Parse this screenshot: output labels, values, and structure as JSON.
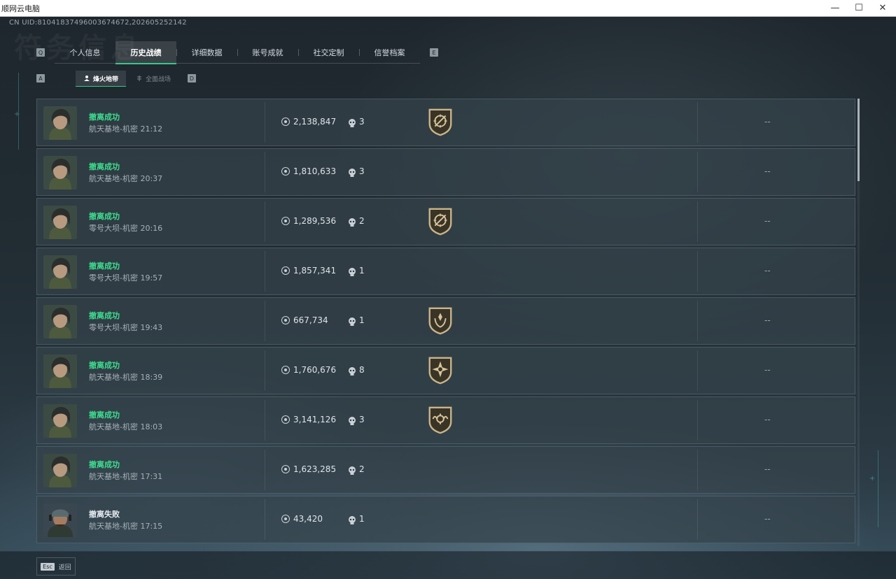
{
  "window": {
    "title": "顺网云电脑",
    "minimize_glyph": "—",
    "maximize_glyph": "☐",
    "close_glyph": "✕"
  },
  "header": {
    "uid": "CN UID:8104183749600367467​2,202605252142",
    "bg_title": "符务信息"
  },
  "tabs": {
    "left_key": "Q",
    "right_key": "E",
    "items": [
      {
        "label": "个人信息"
      },
      {
        "label": "历史战绩"
      },
      {
        "label": "详细数据"
      },
      {
        "label": "账号成就"
      },
      {
        "label": "社交定制"
      },
      {
        "label": "信誉档案"
      }
    ],
    "active_index": 1
  },
  "subtabs": {
    "left_key": "A",
    "right_key": "D",
    "active_label": "烽火地带",
    "inactive_label": "全面战场"
  },
  "records": [
    {
      "status": "撤离成功",
      "map": "航天基地-机密 21:12",
      "value": "2,138,847",
      "kills": "3",
      "badge": "sniper-badge",
      "extra": "--",
      "ok": true
    },
    {
      "status": "撤离成功",
      "map": "航天基地-机密 20:37",
      "value": "1,810,633",
      "kills": "3",
      "badge": "",
      "extra": "--",
      "ok": true
    },
    {
      "status": "撤离成功",
      "map": "零号大坝-机密 20:16",
      "value": "1,289,536",
      "kills": "2",
      "badge": "sniper-badge",
      "extra": "--",
      "ok": true
    },
    {
      "status": "撤离成功",
      "map": "零号大坝-机密 19:57",
      "value": "1,857,341",
      "kills": "1",
      "badge": "",
      "extra": "--",
      "ok": true
    },
    {
      "status": "撤离成功",
      "map": "零号大坝-机密 19:43",
      "value": "667,734",
      "kills": "1",
      "badge": "laurel-badge",
      "extra": "--",
      "ok": true
    },
    {
      "status": "撤离成功",
      "map": "航天基地-机密 18:39",
      "value": "1,760,676",
      "kills": "8",
      "badge": "star-badge",
      "extra": "--",
      "ok": true
    },
    {
      "status": "撤离成功",
      "map": "航天基地-机密 18:03",
      "value": "3,141,126",
      "kills": "3",
      "badge": "wings-badge",
      "extra": "--",
      "ok": true
    },
    {
      "status": "撤离成功",
      "map": "航天基地-机密 17:31",
      "value": "1,623,285",
      "kills": "2",
      "badge": "",
      "extra": "--",
      "ok": true
    },
    {
      "status": "撤离失败",
      "map": "航天基地-机密 17:15",
      "value": "43,420",
      "kills": "1",
      "badge": "",
      "extra": "--",
      "ok": false
    }
  ],
  "footer": {
    "esc_key": "Esc",
    "back_label": "返回"
  },
  "colors": {
    "accent_green": "#38c788",
    "success_text": "#3dde8f",
    "badge_gold": "#c9b48a"
  }
}
